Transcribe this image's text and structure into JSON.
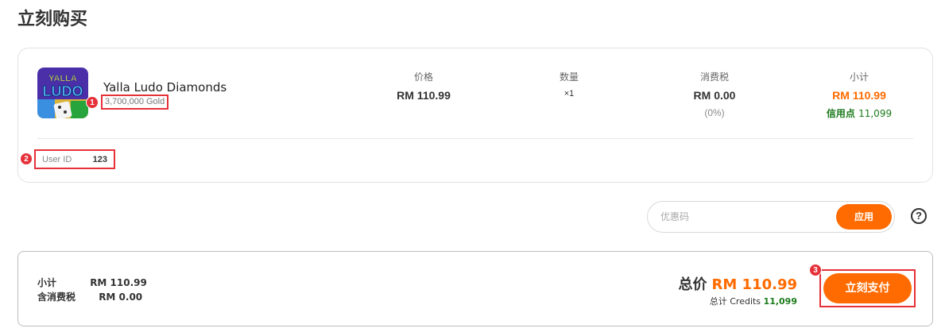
{
  "page_title": "立刻购买",
  "product": {
    "image_icon": "yalla-ludo-logo",
    "logo_text_top": "YALLA",
    "logo_text_main": "LUDO",
    "name": "Yalla Ludo Diamonds",
    "variant": "3,700,000 Gold",
    "columns": {
      "price_header": "价格",
      "price_value": "RM 110.99",
      "qty_header": "数量",
      "qty_value": "×1",
      "tax_header": "消费税",
      "tax_value": "RM 0.00",
      "tax_rate": "(0%)",
      "subtotal_header": "小计",
      "subtotal_value": "RM 110.99",
      "credits_label": "信用点",
      "credits_value": "11,099"
    }
  },
  "user": {
    "label": "User ID",
    "value": "123"
  },
  "markers": [
    "1",
    "2",
    "3"
  ],
  "coupon": {
    "placeholder": "优惠码",
    "value": "",
    "apply_label": "应用",
    "help_icon": "question-circle-icon",
    "help_glyph": "?"
  },
  "summary": {
    "subtotal_label": "小计",
    "subtotal_value": "RM 110.99",
    "tax_label": "含消费税",
    "tax_value": "RM 0.00",
    "total_label": "总价",
    "total_value": "RM 110.99",
    "credits_prefix": "总计 Credits",
    "credits_value": "11,099",
    "pay_label": "立刻支付"
  },
  "colors": {
    "accent": "#ff6b00",
    "highlight_border": "#e5313a",
    "credits_green": "#1a7a1a"
  }
}
